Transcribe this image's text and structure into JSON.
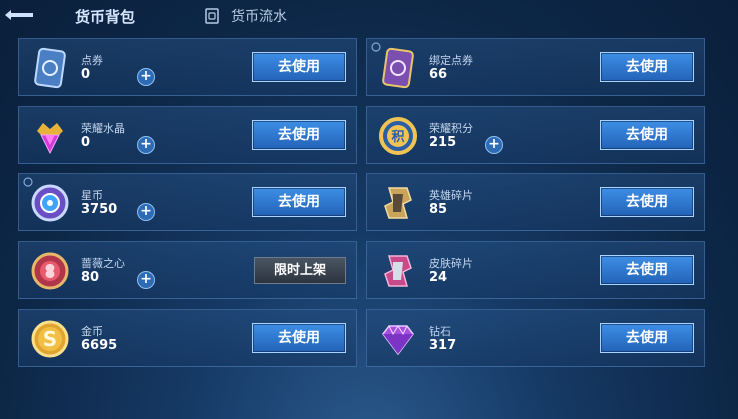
{
  "topbar": {
    "back_icon": "back-arrow-icon",
    "tabs": [
      {
        "label": "货币背包",
        "active": true
      },
      {
        "label": "货币流水",
        "icon": "ledger-icon"
      }
    ]
  },
  "currencies": [
    {
      "name": "点券",
      "amount": "0",
      "icon": "coupon-card-icon",
      "has_plus": true,
      "button": "去使用"
    },
    {
      "name": "绑定点券",
      "amount": "66",
      "icon": "bound-coupon-card-icon",
      "has_plus": false,
      "button": "去使用"
    },
    {
      "name": "荣耀水晶",
      "amount": "0",
      "icon": "glory-crystal-icon",
      "has_plus": true,
      "button": "去使用"
    },
    {
      "name": "荣耀积分",
      "amount": "215",
      "icon": "glory-points-icon",
      "has_plus": true,
      "button": "去使用"
    },
    {
      "name": "星币",
      "amount": "3750",
      "icon": "star-coin-icon",
      "has_plus": true,
      "button": "去使用"
    },
    {
      "name": "英雄碎片",
      "amount": "85",
      "icon": "hero-fragment-icon",
      "has_plus": false,
      "button": "去使用"
    },
    {
      "name": "蔷薇之心",
      "amount": "80",
      "icon": "rose-heart-icon",
      "has_plus": true,
      "button": "限时上架"
    },
    {
      "name": "皮肤碎片",
      "amount": "24",
      "icon": "skin-fragment-icon",
      "has_plus": false,
      "button": "去使用"
    },
    {
      "name": "金币",
      "amount": "6695",
      "icon": "gold-coin-icon",
      "has_plus": false,
      "button": "去使用"
    },
    {
      "name": "钻石",
      "amount": "317",
      "icon": "diamond-icon",
      "has_plus": false,
      "button": "去使用"
    }
  ],
  "colors": {
    "button_blue": "#2f7bd6",
    "limited_button": "#3a434f",
    "card_border": "#5a8cc8"
  }
}
